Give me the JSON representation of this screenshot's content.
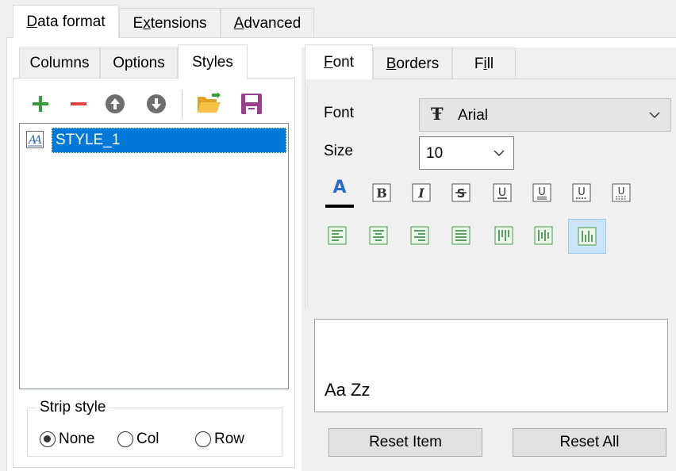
{
  "main_tabs": [
    {
      "label": "Data format",
      "mnemonic_index": 0,
      "active": true
    },
    {
      "label": "Extensions",
      "mnemonic_index": 1,
      "active": false
    },
    {
      "label": "Advanced",
      "mnemonic_index": 0,
      "active": false
    }
  ],
  "left_tabs": [
    {
      "label": "Columns",
      "active": false
    },
    {
      "label": "Options",
      "active": false
    },
    {
      "label": "Styles",
      "active": true
    }
  ],
  "toolbar": {
    "add": "plus-icon",
    "remove": "minus-icon",
    "move_up": "arrow-up-circle-icon",
    "move_down": "arrow-down-circle-icon",
    "open": "folder-open-icon",
    "save": "save-icon"
  },
  "styles_list": {
    "items": [
      {
        "label": "STYLE_1",
        "selected": true
      }
    ]
  },
  "strip_style": {
    "title": "Strip style",
    "options": [
      {
        "label": "None",
        "checked": true
      },
      {
        "label": "Col",
        "checked": false
      },
      {
        "label": "Row",
        "checked": false
      }
    ]
  },
  "right_tabs": [
    {
      "label": "Font",
      "mnemonic_index": 0,
      "active": true
    },
    {
      "label": "Borders",
      "mnemonic_index": 0,
      "active": false
    },
    {
      "label": "Fill",
      "mnemonic_index": 1,
      "active": false
    }
  ],
  "font_panel": {
    "font_label": "Font",
    "font_value": "Arial",
    "size_label": "Size",
    "size_value": "10",
    "text_color": "#000000",
    "style_buttons": [
      "font-color",
      "bold",
      "italic",
      "strikeout",
      "underline-single",
      "underline-double",
      "underline-single-accounting",
      "underline-double-accounting"
    ],
    "align_buttons": [
      "align-left",
      "align-center",
      "align-right",
      "align-justify",
      "valign-top",
      "valign-center",
      "valign-bottom"
    ],
    "selected_align": "valign-bottom"
  },
  "preview": {
    "sample_text": "Aa Zz"
  },
  "buttons": {
    "reset_item": "Reset Item",
    "reset_all": "Reset All"
  },
  "colors": {
    "accent": "#0078d7",
    "add": "#3a9c3a",
    "remove": "#e0443e",
    "circle": "#6e6e6e",
    "folder": "#f2b233",
    "save": "#9b3e8f"
  }
}
